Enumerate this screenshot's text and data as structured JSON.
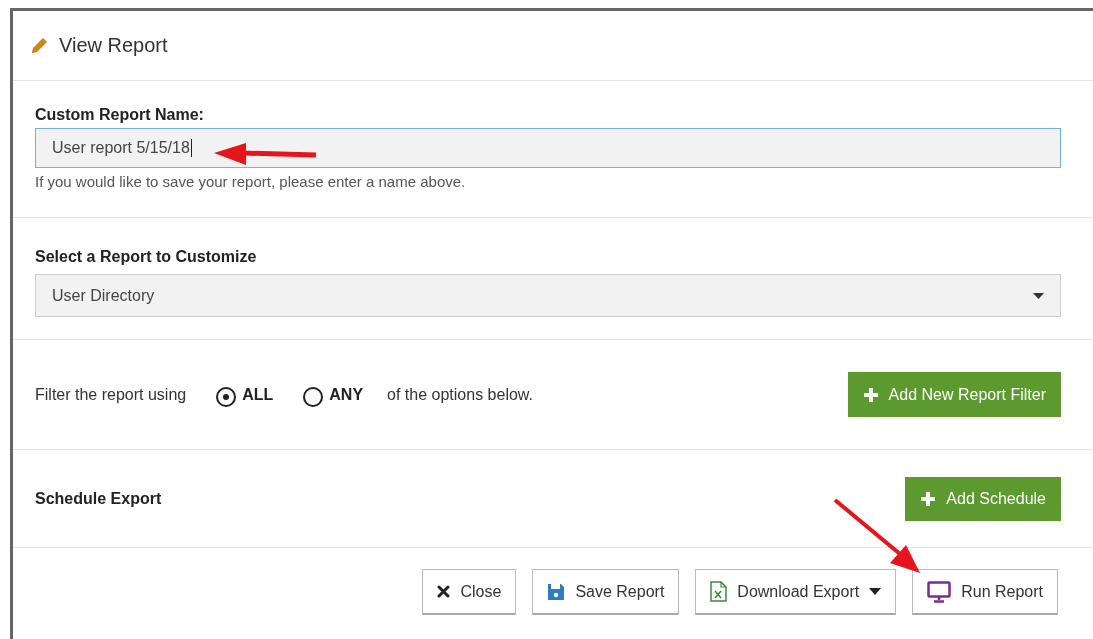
{
  "dialog": {
    "title": "View Report"
  },
  "report_name": {
    "label": "Custom Report Name:",
    "value": "User report 5/15/18",
    "hint": "If you would like to save your report, please enter a name above.",
    "arrow": true
  },
  "report_select": {
    "label": "Select a Report to Customize",
    "value": "User Directory"
  },
  "filter": {
    "prefix": "Filter the report using",
    "options": [
      {
        "label": "ALL",
        "selected": true
      },
      {
        "label": "ANY",
        "selected": false
      }
    ],
    "suffix": "of the options below.",
    "button": "Add New Report Filter"
  },
  "schedule": {
    "label": "Schedule Export",
    "button": "Add Schedule"
  },
  "footer_buttons": [
    {
      "kind": "close",
      "label": "Close",
      "dropdown": false,
      "arrow": false
    },
    {
      "kind": "save",
      "label": "Save Report",
      "dropdown": false,
      "arrow": false
    },
    {
      "kind": "excel",
      "label": "Download Export",
      "dropdown": true,
      "arrow": false
    },
    {
      "kind": "monitor",
      "label": "Run Report",
      "dropdown": false,
      "arrow": true
    }
  ]
}
